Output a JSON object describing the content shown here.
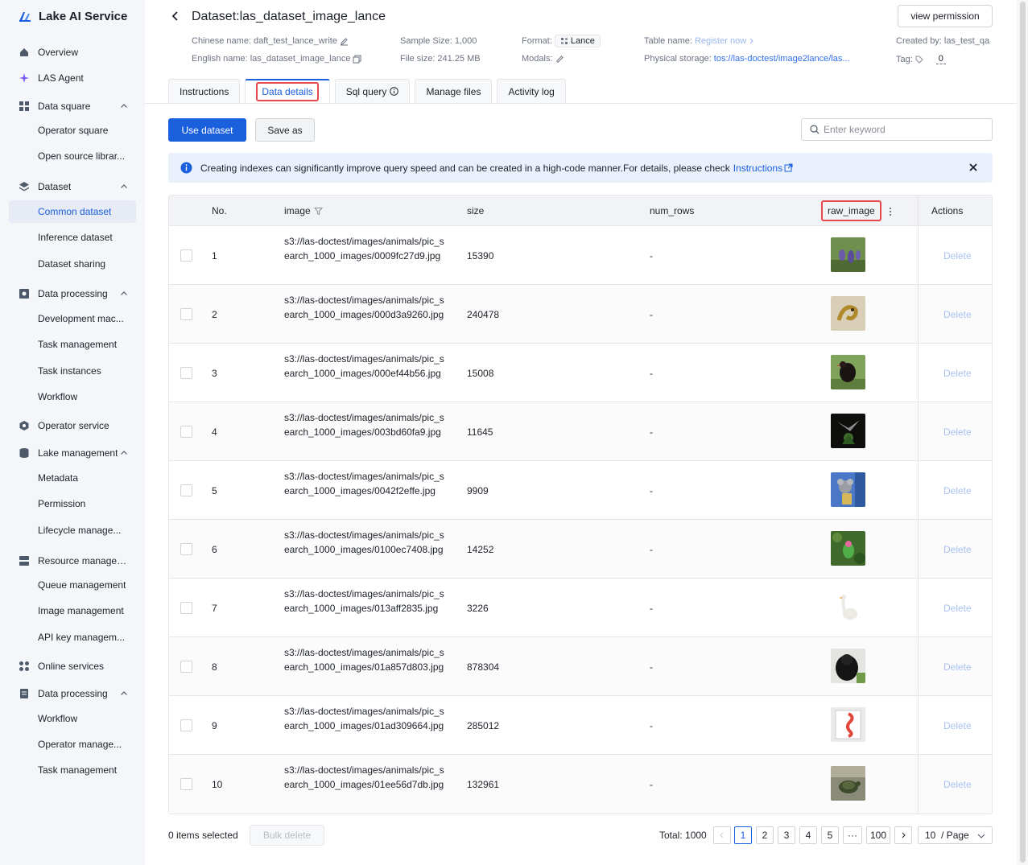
{
  "app": {
    "name": "Lake AI Service"
  },
  "sidebar": {
    "items": [
      {
        "label": "Overview",
        "type": "top",
        "icon": "home-icon"
      },
      {
        "label": "LAS Agent",
        "type": "top",
        "icon": "sparkle-icon"
      },
      {
        "label": "Data square",
        "type": "top",
        "icon": "grid-icon",
        "expanded": true
      },
      {
        "label": "Operator square",
        "type": "sub"
      },
      {
        "label": "Open source librar...",
        "type": "sub"
      },
      {
        "label": "Dataset",
        "type": "top",
        "icon": "layers-icon",
        "expanded": true
      },
      {
        "label": "Common dataset",
        "type": "sub",
        "active": true
      },
      {
        "label": "Inference dataset",
        "type": "sub"
      },
      {
        "label": "Dataset sharing",
        "type": "sub"
      },
      {
        "label": "Data processing",
        "type": "top",
        "icon": "processing-icon",
        "expanded": true
      },
      {
        "label": "Development mac...",
        "type": "sub"
      },
      {
        "label": "Task management",
        "type": "sub"
      },
      {
        "label": "Task instances",
        "type": "sub"
      },
      {
        "label": "Workflow",
        "type": "sub"
      },
      {
        "label": "Operator service",
        "type": "top",
        "icon": "hexagon-icon"
      },
      {
        "label": "Lake management",
        "type": "top",
        "icon": "database-icon",
        "expanded": true
      },
      {
        "label": "Metadata",
        "type": "sub"
      },
      {
        "label": "Permission",
        "type": "sub"
      },
      {
        "label": "Lifecycle manage...",
        "type": "sub"
      },
      {
        "label": "Resource managemen",
        "type": "top",
        "icon": "server-icon"
      },
      {
        "label": "Queue management",
        "type": "sub"
      },
      {
        "label": "Image management",
        "type": "sub"
      },
      {
        "label": "API key managem...",
        "type": "sub"
      },
      {
        "label": "Online services",
        "type": "top",
        "icon": "apps-icon"
      },
      {
        "label": "Data processing",
        "type": "top",
        "icon": "document-icon",
        "expanded": true
      },
      {
        "label": "Workflow",
        "type": "sub"
      },
      {
        "label": "Operator manage...",
        "type": "sub"
      },
      {
        "label": "Task management",
        "type": "sub"
      }
    ]
  },
  "header": {
    "title": "Dataset:las_dataset_image_lance",
    "view_permission": "view permission",
    "chinese_name_label": "Chinese name:",
    "chinese_name": "daft_test_lance_write",
    "english_name_label": "English name:",
    "english_name": "las_dataset_image_lance",
    "sample_size_label": "Sample Size:",
    "sample_size": "1,000",
    "file_size_label": "File size:",
    "file_size": "241.25 MB",
    "format_label": "Format:",
    "format": "Lance",
    "modals_label": "Modals:",
    "table_name_label": "Table name:",
    "table_name_link": "Register now",
    "physical_storage_label": "Physical storage:",
    "physical_storage": "tos://las-doctest/image2lance/las...",
    "created_by_label": "Created by:",
    "created_by": "las_test_qa",
    "tag_label": "Tag:",
    "tag_count": "0"
  },
  "tabs": [
    {
      "label": "Instructions",
      "active": false
    },
    {
      "label": "Data details",
      "active": true
    },
    {
      "label": "Sql query",
      "active": false,
      "info": true
    },
    {
      "label": "Manage files",
      "active": false
    },
    {
      "label": "Activity log",
      "active": false
    }
  ],
  "toolbar": {
    "use_dataset": "Use dataset",
    "save_as": "Save as",
    "search_placeholder": "Enter keyword"
  },
  "alert": {
    "text": "Creating indexes can significantly improve query speed and can be created in a high-code manner.For details, please check",
    "link": "Instructions"
  },
  "table": {
    "columns": [
      "No.",
      "image",
      "size",
      "num_rows",
      "raw_image",
      "Actions"
    ],
    "delete_label": "Delete",
    "rows": [
      {
        "no": "1",
        "image": "s3://las-doctest/images/animals/pic_search_1000_images/0009fc27d9.jpg",
        "size": "15390",
        "num_rows": "-",
        "thumb": "deer"
      },
      {
        "no": "2",
        "image": "s3://las-doctest/images/animals/pic_search_1000_images/000d3a9260.jpg",
        "size": "240478",
        "num_rows": "-",
        "thumb": "lizard"
      },
      {
        "no": "3",
        "image": "s3://las-doctest/images/animals/pic_search_1000_images/000ef44b56.jpg",
        "size": "15008",
        "num_rows": "-",
        "thumb": "bird"
      },
      {
        "no": "4",
        "image": "s3://las-doctest/images/animals/pic_search_1000_images/003bd60fa9.jpg",
        "size": "11645",
        "num_rows": "-",
        "thumb": "hummingbird"
      },
      {
        "no": "5",
        "image": "s3://las-doctest/images/animals/pic_search_1000_images/0042f2effe.jpg",
        "size": "9909",
        "num_rows": "-",
        "thumb": "koala"
      },
      {
        "no": "6",
        "image": "s3://las-doctest/images/animals/pic_search_1000_images/0100ec7408.jpg",
        "size": "14252",
        "num_rows": "-",
        "thumb": "parrot"
      },
      {
        "no": "7",
        "image": "s3://las-doctest/images/animals/pic_search_1000_images/013aff2835.jpg",
        "size": "3226",
        "num_rows": "-",
        "thumb": "goose"
      },
      {
        "no": "8",
        "image": "s3://las-doctest/images/animals/pic_search_1000_images/01a857d803.jpg",
        "size": "878304",
        "num_rows": "-",
        "thumb": "gorilla"
      },
      {
        "no": "9",
        "image": "s3://las-doctest/images/animals/pic_search_1000_images/01ad309664.jpg",
        "size": "285012",
        "num_rows": "-",
        "thumb": "seahorse"
      },
      {
        "no": "10",
        "image": "s3://las-doctest/images/animals/pic_search_1000_images/01ee56d7db.jpg",
        "size": "132961",
        "num_rows": "-",
        "thumb": "turtle"
      }
    ]
  },
  "footer": {
    "selected": "0 items selected",
    "bulk_delete": "Bulk delete",
    "total": "Total: 1000",
    "pages": [
      "1",
      "2",
      "3",
      "4",
      "5",
      "···",
      "100"
    ],
    "current_page": "1",
    "page_size": "10  / Page"
  },
  "colors": {
    "primary": "#1a5fdc",
    "highlight": "#e5484d",
    "sidebar_bg": "#f4f6f9"
  }
}
